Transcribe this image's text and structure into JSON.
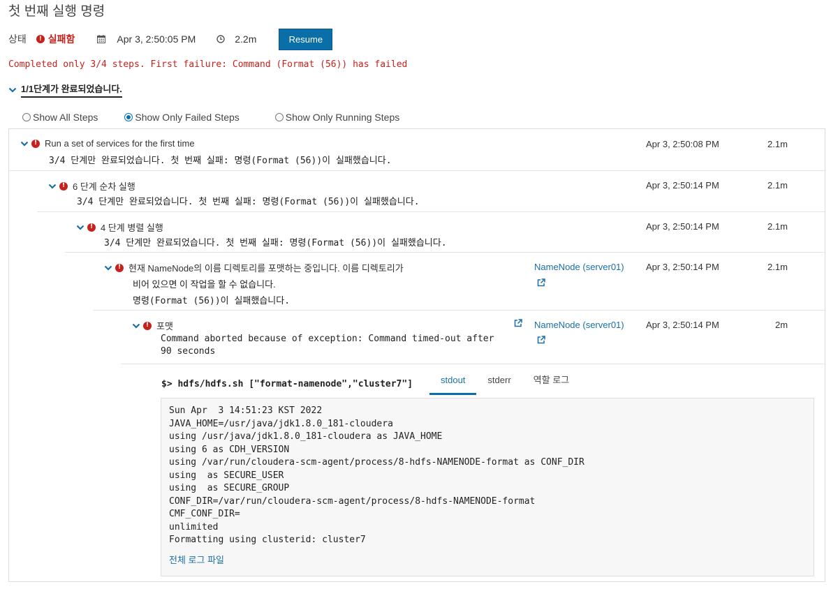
{
  "page": {
    "title": "첫 번째 실행 명령"
  },
  "status": {
    "label": "상태",
    "value": "실패함",
    "start_time": "Apr 3, 2:50:05 PM",
    "duration": "2.2m",
    "resume_label": "Resume"
  },
  "error_message": "Completed only 3/4 steps. First failure: Command (Format (56)) has failed",
  "summary": "1/1단계가 완료되었습니다.",
  "filters": {
    "all": "Show All Steps",
    "failed": "Show Only Failed Steps",
    "running": "Show Only Running Steps",
    "selected": "failed"
  },
  "steps": [
    {
      "title": "Run a set of services for the first time",
      "description": "3/4 단계만 완료되었습니다. 첫 번째 실패: 명령(Format (56))이 실패했습니다.",
      "time": "Apr 3, 2:50:08 PM",
      "duration": "2.1m"
    },
    {
      "title": "6 단계 순차 실행",
      "description": "3/4 단계만 완료되었습니다. 첫 번째 실패: 명령(Format (56))이 실패했습니다.",
      "time": "Apr 3, 2:50:14 PM",
      "duration": "2.1m"
    },
    {
      "title": "4 단계 병렬 실행",
      "description": "3/4 단계만 완료되었습니다. 첫 번째 실패: 명령(Format (56))이 실패했습니다.",
      "time": "Apr 3, 2:50:14 PM",
      "duration": "2.1m"
    },
    {
      "title_line1": "현재 NameNode의 이름 디렉토리를 포맷하는 중입니다. 이름 디렉토리가",
      "title_line2": "비어 있으면 이 작업을 할 수 없습니다.",
      "description": "명령(Format (56))이 실패했습니다.",
      "host": "NameNode (server01)",
      "time": "Apr 3, 2:50:14 PM",
      "duration": "2.1m"
    },
    {
      "title": "포맷",
      "description_line1": "Command aborted because of exception: Command timed-out after",
      "description_line2": "90 seconds",
      "host": "NameNode (server01)",
      "time": "Apr 3, 2:50:14 PM",
      "duration": "2m"
    }
  ],
  "command": {
    "line": "$> hdfs/hdfs.sh [\"format-namenode\",\"cluster7\"]",
    "tabs": [
      "stdout",
      "stderr",
      "역할 로그"
    ],
    "active_tab": "stdout",
    "log_lines": [
      "Sun Apr  3 14:51:23 KST 2022",
      "JAVA_HOME=/usr/java/jdk1.8.0_181-cloudera",
      "using /usr/java/jdk1.8.0_181-cloudera as JAVA_HOME",
      "using 6 as CDH_VERSION",
      "using /var/run/cloudera-scm-agent/process/8-hdfs-NAMENODE-format as CONF_DIR",
      "using  as SECURE_USER",
      "using  as SECURE_GROUP",
      "CONF_DIR=/var/run/cloudera-scm-agent/process/8-hdfs-NAMENODE-format",
      "CMF_CONF_DIR=",
      "unlimited",
      "Formatting using clusterid: cluster7"
    ],
    "full_log_link": "전체 로그 파일"
  },
  "colors": {
    "accent": "#0a6ea8",
    "error": "#c7211c",
    "link": "#1a6fa6"
  }
}
